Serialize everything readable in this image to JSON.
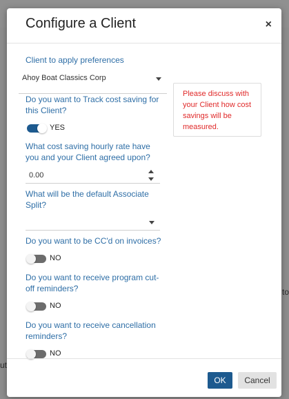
{
  "background": {
    "right_fragment": "to",
    "left_fragment": "ut",
    "bottom_fragment": "Client"
  },
  "modal": {
    "title": "Configure a Client",
    "close_label": "×"
  },
  "client": {
    "label": "Client to apply preferences",
    "selected": "Ahoy Boat Classics Corp"
  },
  "track_cost": {
    "question": "Do you want to Track cost saving for this Client?",
    "state_label": "YES",
    "on": true
  },
  "hourly_rate": {
    "question": "What cost saving hourly rate have you and your Client agreed upon?",
    "value": "0.00"
  },
  "associate_split": {
    "question": "What will be the default Associate Split?",
    "selected": ""
  },
  "cc_invoices": {
    "question": "Do you want to be CC'd on invoices?",
    "state_label": "NO",
    "on": false
  },
  "cutoff_reminders": {
    "question": "Do you want to receive program cut-off reminders?",
    "state_label": "NO",
    "on": false
  },
  "cancellation_reminders": {
    "question": "Do you want to receive cancellation reminders?",
    "state_label": "NO",
    "on": false
  },
  "notice": {
    "text": "Please discuss with your Client how cost savings will be measured."
  },
  "footer": {
    "ok_label": "OK",
    "cancel_label": "Cancel"
  },
  "colors": {
    "accent": "#1d5a8f",
    "label_blue": "#2e6ea6",
    "notice_red": "#e02a2a"
  }
}
